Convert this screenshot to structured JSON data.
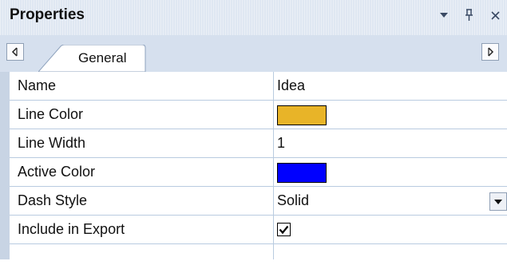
{
  "panel": {
    "title": "Properties",
    "title_icons": [
      "dropdown-arrow-icon",
      "pin-icon",
      "close-icon"
    ]
  },
  "tabs": [
    {
      "label": "General",
      "selected": true
    }
  ],
  "properties": [
    {
      "name": "Name",
      "value": "Idea",
      "kind": "text"
    },
    {
      "name": "Line Color",
      "value": "",
      "kind": "color",
      "color": "#e8b428"
    },
    {
      "name": "Line Width",
      "value": "1",
      "kind": "text"
    },
    {
      "name": "Active Color",
      "value": "",
      "kind": "color",
      "color": "#0000ff"
    },
    {
      "name": "Dash Style",
      "value": "Solid",
      "kind": "dropdown"
    },
    {
      "name": "Include in Export",
      "value": "",
      "kind": "checkbox",
      "checked": true
    }
  ]
}
